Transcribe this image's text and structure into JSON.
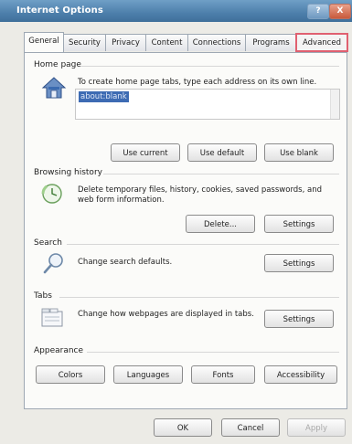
{
  "window": {
    "title": "Internet Options",
    "help_label": "?",
    "close_label": "X"
  },
  "tabs": [
    {
      "label": "General",
      "active": true
    },
    {
      "label": "Security"
    },
    {
      "label": "Privacy"
    },
    {
      "label": "Content"
    },
    {
      "label": "Connections"
    },
    {
      "label": "Programs"
    },
    {
      "label": "Advanced",
      "highlighted": true
    }
  ],
  "home_page": {
    "title": "Home page",
    "description": "To create home page tabs, type each address on its own line.",
    "url_value": "about:blank",
    "use_current": "Use current",
    "use_default": "Use default",
    "use_blank": "Use blank"
  },
  "browsing_history": {
    "title": "Browsing history",
    "description": "Delete temporary files, history, cookies, saved passwords, and web form information.",
    "delete_label": "Delete...",
    "settings_label": "Settings"
  },
  "search": {
    "title": "Search",
    "description": "Change search defaults.",
    "settings_label": "Settings"
  },
  "tabs_section": {
    "title": "Tabs",
    "description": "Change how webpages are displayed in tabs.",
    "settings_label": "Settings"
  },
  "appearance": {
    "title": "Appearance",
    "colors": "Colors",
    "languages": "Languages",
    "fonts": "Fonts",
    "accessibility": "Accessibility"
  },
  "footer": {
    "ok": "OK",
    "cancel": "Cancel",
    "apply": "Apply"
  }
}
